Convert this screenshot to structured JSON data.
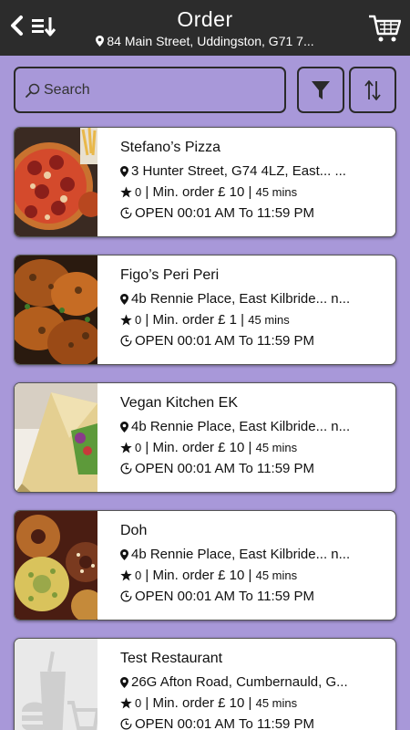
{
  "header": {
    "title": "Order",
    "address": "84 Main Street, Uddingston, G71 7..."
  },
  "search": {
    "placeholder": "Search"
  },
  "restaurants": [
    {
      "name": "Stefano’s Pizza",
      "address": "3 Hunter Street, G74 4LZ, East... ...",
      "rating": "0",
      "min_order": "Min. order £ 10",
      "time": "45 mins",
      "hours": "OPEN 00:01 AM To 11:59 PM",
      "image": "pizza"
    },
    {
      "name": "Figo’s Peri Peri",
      "address": "4b Rennie Place, East Kilbride... n...",
      "rating": "0",
      "min_order": "Min. order £ 1",
      "time": "45 mins",
      "hours": "OPEN 00:01 AM To 11:59 PM",
      "image": "chicken"
    },
    {
      "name": "Vegan Kitchen EK",
      "address": "4b Rennie Place, East Kilbride... n...",
      "rating": "0",
      "min_order": "Min. order £ 10",
      "time": "45 mins",
      "hours": "OPEN 00:01 AM To 11:59 PM",
      "image": "wrap"
    },
    {
      "name": "Doh",
      "address": "4b Rennie Place, East Kilbride... n...",
      "rating": "0",
      "min_order": "Min. order £ 10",
      "time": "45 mins",
      "hours": "OPEN 00:01 AM To 11:59 PM",
      "image": "donuts"
    },
    {
      "name": "Test Restaurant",
      "address": "26G Afton Road, Cumbernauld, G...",
      "rating": "0",
      "min_order": "Min. order £ 10",
      "time": "45 mins",
      "hours": "OPEN 00:01 AM To 11:59 PM",
      "image": "placeholder"
    }
  ]
}
